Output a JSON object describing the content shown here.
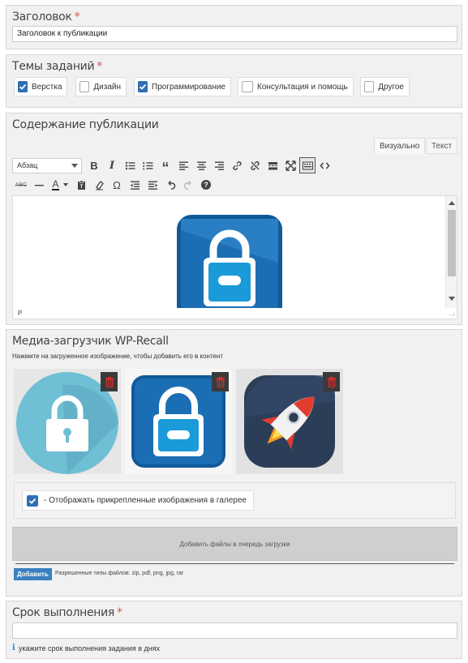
{
  "title_section": {
    "label": "Заголовок",
    "required_mark": "*",
    "input_value": "Заголовок к публикации"
  },
  "topics_section": {
    "label": "Темы заданий",
    "required_mark": "*",
    "options": [
      {
        "label": "Верстка",
        "checked": true
      },
      {
        "label": "Дизайн",
        "checked": false
      },
      {
        "label": "Программирование",
        "checked": true
      },
      {
        "label": "Консультация и помощь",
        "checked": false
      },
      {
        "label": "Другое",
        "checked": false
      }
    ]
  },
  "content_section": {
    "label": "Содержание публикации",
    "tabs": {
      "visual": "Визуально",
      "text": "Текст"
    },
    "format_select": "Абзац",
    "path": "P",
    "toolbar_row1_icons": [
      "bold-icon",
      "italic-icon",
      "bullet-list-icon",
      "numbered-list-icon",
      "blockquote-icon",
      "align-left-icon",
      "align-center-icon",
      "align-right-icon",
      "link-icon",
      "unlink-icon",
      "read-more-icon",
      "fullscreen-icon",
      "toolbar-toggle-icon",
      "code-icon"
    ],
    "toolbar_row2_icons": [
      "strikethrough-icon",
      "horizontal-line-icon",
      "text-color-icon",
      "paste-text-icon",
      "clear-formatting-icon",
      "special-char-icon",
      "outdent-icon",
      "indent-icon",
      "undo-icon",
      "redo-icon",
      "help-icon"
    ],
    "bold_glyph": "B",
    "italic_glyph": "I",
    "strike_glyph": "ABC",
    "color_glyph": "A",
    "omega_glyph": "Ω",
    "help_glyph": "?"
  },
  "media_section": {
    "label": "Медиа-загрузчик WP-Recall",
    "hint": "Нажмите на загруженное изображение, чтобы добавить его в контент",
    "thumbnails": [
      {
        "icon": "lock-icon",
        "bg": "#6fbfd5"
      },
      {
        "icon": "lock-icon",
        "bg": "#1a6fb0"
      },
      {
        "icon": "rocket-icon",
        "bg": "#2c3e57"
      }
    ],
    "gallery_checkbox": {
      "checked": true,
      "label": "- Отображать прикрепленные изображения в галерее"
    },
    "dropzone_label": "Добавить файлы в очередь загрузки",
    "add_button": "Добавить",
    "allowed_types": "Разрешенные типы файлов: zip, pdf, png, jpg, rar"
  },
  "deadline_section": {
    "label": "Срок выполнения",
    "required_mark": "*",
    "input_value": "",
    "hint_icon": "info-icon",
    "hint": "укажите срок выполнения задания в днях"
  },
  "colors": {
    "accent": "#2f6fb3",
    "required": "#d9534f",
    "panel_bg": "#f1f1f1",
    "lock_blue": "#1b6eb3"
  }
}
